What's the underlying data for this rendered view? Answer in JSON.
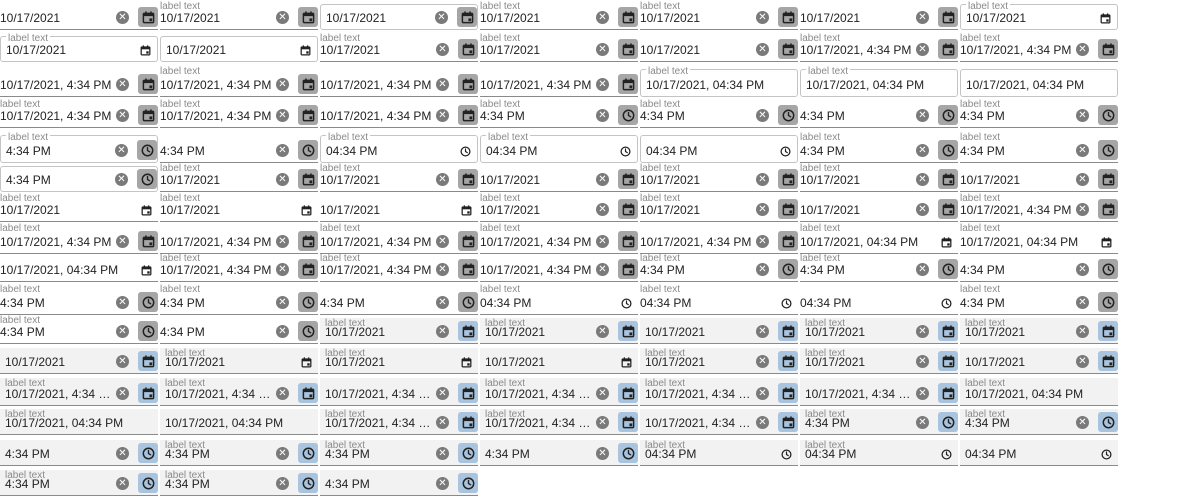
{
  "label": "label text",
  "icons": {
    "clear": "clear-icon",
    "calendar": "calendar-icon",
    "clock": "clock-icon"
  },
  "colors": {
    "button_gray": "#a6a6a6",
    "button_blue": "#a9c4de",
    "label_gray": "#8a8a8a"
  },
  "fields": [
    {
      "v": "10/17/2021",
      "lb": false,
      "st": "u",
      "c": true,
      "ic": "cal",
      "ik": "btn",
      "tn": "g"
    },
    {
      "v": "10/17/2021",
      "lb": true,
      "st": "u",
      "c": true,
      "ic": "cal",
      "ik": "btn",
      "tn": "g"
    },
    {
      "v": "10/17/2021",
      "lb": false,
      "st": "o",
      "c": true,
      "ic": "cal",
      "ik": "btn",
      "tn": "g"
    },
    {
      "v": "10/17/2021",
      "lb": true,
      "st": "u",
      "c": true,
      "ic": "cal",
      "ik": "btn",
      "tn": "g"
    },
    {
      "v": "10/17/2021",
      "lb": true,
      "st": "u",
      "c": true,
      "ic": "cal",
      "ik": "btn",
      "tn": "g"
    },
    {
      "v": "10/17/2021",
      "lb": false,
      "st": "u",
      "c": true,
      "ic": "cal",
      "ik": "btn",
      "tn": "g"
    },
    {
      "v": "10/17/2021",
      "lb": true,
      "st": "o",
      "c": false,
      "ic": "cal",
      "ik": "plain",
      "tn": "g"
    },
    {
      "v": "10/17/2021",
      "lb": true,
      "st": "o",
      "c": false,
      "ic": "cal",
      "ik": "plain",
      "tn": "g"
    },
    {
      "v": "10/17/2021",
      "lb": false,
      "st": "o",
      "c": false,
      "ic": "cal",
      "ik": "plain",
      "tn": "g"
    },
    {
      "v": "10/17/2021",
      "lb": true,
      "st": "u",
      "c": true,
      "ic": "cal",
      "ik": "btn",
      "tn": "g"
    },
    {
      "v": "10/17/2021",
      "lb": true,
      "st": "u",
      "c": true,
      "ic": "cal",
      "ik": "btn",
      "tn": "g"
    },
    {
      "v": "10/17/2021",
      "lb": false,
      "st": "u",
      "c": true,
      "ic": "cal",
      "ik": "btn",
      "tn": "g"
    },
    {
      "v": "10/17/2021, 4:34 PM",
      "lb": true,
      "st": "u",
      "c": true,
      "ic": "cal",
      "ik": "btn",
      "tn": "g"
    },
    {
      "v": "10/17/2021, 4:34 PM",
      "lb": true,
      "st": "u",
      "c": true,
      "ic": "cal",
      "ik": "btn",
      "tn": "g"
    },
    {
      "v": "10/17/2021, 4:34 PM",
      "lb": false,
      "st": "u",
      "c": true,
      "ic": "cal",
      "ik": "btn",
      "tn": "g"
    },
    {
      "v": "10/17/2021, 4:34 PM",
      "lb": true,
      "st": "u",
      "c": true,
      "ic": "cal",
      "ik": "btn",
      "tn": "g"
    },
    {
      "v": "10/17/2021, 4:34 PM",
      "lb": false,
      "st": "u",
      "c": true,
      "ic": "cal",
      "ik": "btn",
      "tn": "g"
    },
    {
      "v": "10/17/2021, 4:34 PM",
      "lb": false,
      "st": "u",
      "c": true,
      "ic": "cal",
      "ik": "btn",
      "tn": "g"
    },
    {
      "v": "10/17/2021, 04:34  PM",
      "lb": true,
      "st": "o",
      "c": false,
      "ic": "none",
      "ik": "none",
      "tn": "g"
    },
    {
      "v": "10/17/2021, 04:34  PM",
      "lb": true,
      "st": "o",
      "c": false,
      "ic": "none",
      "ik": "none",
      "tn": "g"
    },
    {
      "v": "10/17/2021, 04:34  PM",
      "lb": false,
      "st": "o",
      "c": false,
      "ic": "none",
      "ik": "none",
      "tn": "g"
    },
    {
      "v": "10/17/2021, 4:34 PM",
      "lb": true,
      "st": "u",
      "c": true,
      "ic": "cal",
      "ik": "btn",
      "tn": "g"
    },
    {
      "v": "10/17/2021, 4:34 PM",
      "lb": true,
      "st": "u",
      "c": true,
      "ic": "cal",
      "ik": "btn",
      "tn": "g"
    },
    {
      "v": "10/17/2021, 4:34 PM",
      "lb": false,
      "st": "u",
      "c": true,
      "ic": "cal",
      "ik": "btn",
      "tn": "g"
    },
    {
      "v": "4:34 PM",
      "lb": true,
      "st": "u",
      "c": true,
      "ic": "clk",
      "ik": "btn",
      "tn": "g"
    },
    {
      "v": "4:34 PM",
      "lb": true,
      "st": "u",
      "c": true,
      "ic": "clk",
      "ik": "btn",
      "tn": "g"
    },
    {
      "v": "4:34 PM",
      "lb": false,
      "st": "u",
      "c": true,
      "ic": "clk",
      "ik": "btn",
      "tn": "g"
    },
    {
      "v": "4:34 PM",
      "lb": true,
      "st": "u",
      "c": true,
      "ic": "clk",
      "ik": "btn",
      "tn": "g"
    },
    {
      "v": "4:34 PM",
      "lb": true,
      "st": "o",
      "c": true,
      "ic": "clk",
      "ik": "btn",
      "tn": "g"
    },
    {
      "v": "4:34 PM",
      "lb": false,
      "st": "u",
      "c": true,
      "ic": "clk",
      "ik": "btn",
      "tn": "g"
    },
    {
      "v": "04:34  PM",
      "lb": true,
      "st": "o",
      "c": false,
      "ic": "clk",
      "ik": "plain",
      "tn": "g"
    },
    {
      "v": "04:34  PM",
      "lb": true,
      "st": "o",
      "c": false,
      "ic": "clk",
      "ik": "plain",
      "tn": "g"
    },
    {
      "v": "04:34  PM",
      "lb": false,
      "st": "o",
      "c": false,
      "ic": "clk",
      "ik": "plain",
      "tn": "g"
    },
    {
      "v": "4:34 PM",
      "lb": true,
      "st": "u",
      "c": true,
      "ic": "clk",
      "ik": "btn",
      "tn": "g"
    },
    {
      "v": "4:34 PM",
      "lb": true,
      "st": "u",
      "c": true,
      "ic": "clk",
      "ik": "btn",
      "tn": "g"
    },
    {
      "v": "4:34 PM",
      "lb": false,
      "st": "o",
      "c": true,
      "ic": "clk",
      "ik": "btn",
      "tn": "g"
    },
    {
      "v": "10/17/2021",
      "lb": true,
      "st": "u",
      "c": true,
      "ic": "cal",
      "ik": "btn",
      "tn": "g"
    },
    {
      "v": "10/17/2021",
      "lb": true,
      "st": "u",
      "c": true,
      "ic": "cal",
      "ik": "btn",
      "tn": "g"
    },
    {
      "v": "10/17/2021",
      "lb": false,
      "st": "u",
      "c": true,
      "ic": "cal",
      "ik": "btn",
      "tn": "g"
    },
    {
      "v": "10/17/2021",
      "lb": true,
      "st": "u",
      "c": true,
      "ic": "cal",
      "ik": "btn",
      "tn": "g"
    },
    {
      "v": "10/17/2021",
      "lb": true,
      "st": "u",
      "c": true,
      "ic": "cal",
      "ik": "btn",
      "tn": "g"
    },
    {
      "v": "10/17/2021",
      "lb": false,
      "st": "u",
      "c": true,
      "ic": "cal",
      "ik": "btn",
      "tn": "g"
    },
    {
      "v": "10/17/2021",
      "lb": true,
      "st": "u",
      "c": false,
      "ic": "cal",
      "ik": "plain",
      "tn": "g"
    },
    {
      "v": "10/17/2021",
      "lb": true,
      "st": "u",
      "c": false,
      "ic": "cal",
      "ik": "plain",
      "tn": "g"
    },
    {
      "v": "10/17/2021",
      "lb": false,
      "st": "u",
      "c": false,
      "ic": "cal",
      "ik": "plain",
      "tn": "g"
    },
    {
      "v": "10/17/2021",
      "lb": true,
      "st": "u",
      "c": true,
      "ic": "cal",
      "ik": "btn",
      "tn": "g"
    },
    {
      "v": "10/17/2021",
      "lb": true,
      "st": "u",
      "c": true,
      "ic": "cal",
      "ik": "btn",
      "tn": "g"
    },
    {
      "v": "10/17/2021",
      "lb": false,
      "st": "u",
      "c": true,
      "ic": "cal",
      "ik": "btn",
      "tn": "g"
    },
    {
      "v": "10/17/2021, 4:34 PM",
      "lb": true,
      "st": "u",
      "c": true,
      "ic": "cal",
      "ik": "btn",
      "tn": "g"
    },
    {
      "v": "10/17/2021, 4:34 PM",
      "lb": true,
      "st": "u",
      "c": true,
      "ic": "cal",
      "ik": "btn",
      "tn": "g"
    },
    {
      "v": "10/17/2021, 4:34 PM",
      "lb": false,
      "st": "u",
      "c": true,
      "ic": "cal",
      "ik": "btn",
      "tn": "g"
    },
    {
      "v": "10/17/2021, 4:34 PM",
      "lb": true,
      "st": "u",
      "c": true,
      "ic": "cal",
      "ik": "btn",
      "tn": "g"
    },
    {
      "v": "10/17/2021, 4:34 PM",
      "lb": true,
      "st": "u",
      "c": true,
      "ic": "cal",
      "ik": "btn",
      "tn": "g"
    },
    {
      "v": "10/17/2021, 4:34 PM",
      "lb": false,
      "st": "u",
      "c": true,
      "ic": "cal",
      "ik": "btn",
      "tn": "g"
    },
    {
      "v": "10/17/2021, 04:34  PM",
      "lb": true,
      "st": "u",
      "c": false,
      "ic": "cal",
      "ik": "plain",
      "tn": "g"
    },
    {
      "v": "10/17/2021, 04:34  PM",
      "lb": true,
      "st": "u",
      "c": false,
      "ic": "cal",
      "ik": "plain",
      "tn": "g"
    },
    {
      "v": "10/17/2021, 04:34  PM",
      "lb": false,
      "st": "u",
      "c": false,
      "ic": "cal",
      "ik": "plain",
      "tn": "g"
    },
    {
      "v": "10/17/2021, 4:34 PM",
      "lb": true,
      "st": "u",
      "c": true,
      "ic": "cal",
      "ik": "btn",
      "tn": "g"
    },
    {
      "v": "10/17/2021, 4:34 PM",
      "lb": true,
      "st": "u",
      "c": true,
      "ic": "cal",
      "ik": "btn",
      "tn": "g"
    },
    {
      "v": "10/17/2021, 4:34 PM",
      "lb": false,
      "st": "u",
      "c": true,
      "ic": "cal",
      "ik": "btn",
      "tn": "g"
    },
    {
      "v": "4:34 PM",
      "lb": true,
      "st": "u",
      "c": true,
      "ic": "clk",
      "ik": "btn",
      "tn": "g"
    },
    {
      "v": "4:34 PM",
      "lb": true,
      "st": "u",
      "c": true,
      "ic": "clk",
      "ik": "btn",
      "tn": "g"
    },
    {
      "v": "4:34 PM",
      "lb": false,
      "st": "u",
      "c": true,
      "ic": "clk",
      "ik": "btn",
      "tn": "g"
    },
    {
      "v": "4:34 PM",
      "lb": true,
      "st": "u",
      "c": true,
      "ic": "clk",
      "ik": "btn",
      "tn": "g"
    },
    {
      "v": "4:34 PM",
      "lb": true,
      "st": "u",
      "c": true,
      "ic": "clk",
      "ik": "btn",
      "tn": "g"
    },
    {
      "v": "4:34 PM",
      "lb": false,
      "st": "u",
      "c": true,
      "ic": "clk",
      "ik": "btn",
      "tn": "g"
    },
    {
      "v": "04:34  PM",
      "lb": true,
      "st": "u",
      "c": false,
      "ic": "clk",
      "ik": "plain",
      "tn": "g"
    },
    {
      "v": "04:34  PM",
      "lb": true,
      "st": "u",
      "c": false,
      "ic": "clk",
      "ik": "plain",
      "tn": "g"
    },
    {
      "v": "04:34  PM",
      "lb": false,
      "st": "u",
      "c": false,
      "ic": "clk",
      "ik": "plain",
      "tn": "g"
    },
    {
      "v": "4:34 PM",
      "lb": true,
      "st": "u",
      "c": true,
      "ic": "clk",
      "ik": "btn",
      "tn": "g"
    },
    {
      "v": "4:34 PM",
      "lb": true,
      "st": "u",
      "c": true,
      "ic": "clk",
      "ik": "btn",
      "tn": "g"
    },
    {
      "v": "4:34 PM",
      "lb": false,
      "st": "u",
      "c": true,
      "ic": "clk",
      "ik": "btn",
      "tn": "g"
    },
    {
      "v": "10/17/2021",
      "lb": true,
      "st": "f",
      "c": true,
      "ic": "cal",
      "ik": "btn",
      "tn": "b"
    },
    {
      "v": "10/17/2021",
      "lb": true,
      "st": "f",
      "c": true,
      "ic": "cal",
      "ik": "btn",
      "tn": "b"
    },
    {
      "v": "10/17/2021",
      "lb": false,
      "st": "f",
      "c": true,
      "ic": "cal",
      "ik": "btn",
      "tn": "b"
    },
    {
      "v": "10/17/2021",
      "lb": true,
      "st": "f",
      "c": true,
      "ic": "cal",
      "ik": "btn",
      "tn": "b"
    },
    {
      "v": "10/17/2021",
      "lb": true,
      "st": "f",
      "c": true,
      "ic": "cal",
      "ik": "btn",
      "tn": "b"
    },
    {
      "v": "10/17/2021",
      "lb": false,
      "st": "f",
      "c": true,
      "ic": "cal",
      "ik": "btn",
      "tn": "b"
    },
    {
      "v": "10/17/2021",
      "lb": true,
      "st": "f",
      "c": false,
      "ic": "cal",
      "ik": "plain",
      "tn": "b"
    },
    {
      "v": "10/17/2021",
      "lb": true,
      "st": "f",
      "c": false,
      "ic": "cal",
      "ik": "plain",
      "tn": "b"
    },
    {
      "v": "10/17/2021",
      "lb": false,
      "st": "f",
      "c": false,
      "ic": "cal",
      "ik": "plain",
      "tn": "b"
    },
    {
      "v": "10/17/2021",
      "lb": true,
      "st": "f",
      "c": true,
      "ic": "cal",
      "ik": "btn",
      "tn": "b"
    },
    {
      "v": "10/17/2021",
      "lb": true,
      "st": "f",
      "c": true,
      "ic": "cal",
      "ik": "btn",
      "tn": "b"
    },
    {
      "v": "10/17/2021",
      "lb": false,
      "st": "f",
      "c": true,
      "ic": "cal",
      "ik": "btn",
      "tn": "b"
    },
    {
      "v": "10/17/2021, 4:34 PM",
      "lb": true,
      "st": "f",
      "c": true,
      "ic": "cal",
      "ik": "btn",
      "tn": "b"
    },
    {
      "v": "10/17/2021, 4:34 PM",
      "lb": true,
      "st": "f",
      "c": true,
      "ic": "cal",
      "ik": "btn",
      "tn": "b"
    },
    {
      "v": "10/17/2021, 4:34 PM",
      "lb": false,
      "st": "f",
      "c": true,
      "ic": "cal",
      "ik": "btn",
      "tn": "b"
    },
    {
      "v": "10/17/2021, 4:34 PM",
      "lb": true,
      "st": "f",
      "c": true,
      "ic": "cal",
      "ik": "btn",
      "tn": "b"
    },
    {
      "v": "10/17/2021, 4:34 PM",
      "lb": true,
      "st": "f",
      "c": true,
      "ic": "cal",
      "ik": "btn",
      "tn": "b"
    },
    {
      "v": "10/17/2021, 4:34 PM",
      "lb": false,
      "st": "f",
      "c": true,
      "ic": "cal",
      "ik": "btn",
      "tn": "b"
    },
    {
      "v": "10/17/2021, 04:34  PM",
      "lb": true,
      "st": "f",
      "c": false,
      "ic": "none",
      "ik": "none",
      "tn": "b"
    },
    {
      "v": "10/17/2021, 04:34  PM",
      "lb": true,
      "st": "f",
      "c": false,
      "ic": "none",
      "ik": "none",
      "tn": "b"
    },
    {
      "v": "10/17/2021, 04:34  PM",
      "lb": false,
      "st": "f",
      "c": false,
      "ic": "none",
      "ik": "none",
      "tn": "b"
    },
    {
      "v": "10/17/2021, 4:34 PM",
      "lb": true,
      "st": "f",
      "c": true,
      "ic": "cal",
      "ik": "btn",
      "tn": "b"
    },
    {
      "v": "10/17/2021, 4:34 PM",
      "lb": true,
      "st": "f",
      "c": true,
      "ic": "cal",
      "ik": "btn",
      "tn": "b"
    },
    {
      "v": "10/17/2021, 4:34 PM",
      "lb": false,
      "st": "f",
      "c": true,
      "ic": "cal",
      "ik": "btn",
      "tn": "b"
    },
    {
      "v": "4:34 PM",
      "lb": true,
      "st": "f",
      "c": true,
      "ic": "clk",
      "ik": "btn",
      "tn": "b"
    },
    {
      "v": "4:34 PM",
      "lb": true,
      "st": "f",
      "c": true,
      "ic": "clk",
      "ik": "btn",
      "tn": "b"
    },
    {
      "v": "4:34 PM",
      "lb": false,
      "st": "f",
      "c": true,
      "ic": "clk",
      "ik": "btn",
      "tn": "b"
    },
    {
      "v": "4:34 PM",
      "lb": true,
      "st": "f",
      "c": true,
      "ic": "clk",
      "ik": "btn",
      "tn": "b"
    },
    {
      "v": "4:34 PM",
      "lb": true,
      "st": "f",
      "c": true,
      "ic": "clk",
      "ik": "btn",
      "tn": "b"
    },
    {
      "v": "4:34 PM",
      "lb": false,
      "st": "f",
      "c": true,
      "ic": "clk",
      "ik": "btn",
      "tn": "b"
    },
    {
      "v": "04:34  PM",
      "lb": true,
      "st": "f",
      "c": false,
      "ic": "clk",
      "ik": "plain",
      "tn": "b"
    },
    {
      "v": "04:34  PM",
      "lb": true,
      "st": "f",
      "c": false,
      "ic": "clk",
      "ik": "plain",
      "tn": "b"
    },
    {
      "v": "04:34  PM",
      "lb": false,
      "st": "f",
      "c": false,
      "ic": "clk",
      "ik": "plain",
      "tn": "b"
    },
    {
      "v": "4:34 PM",
      "lb": true,
      "st": "f",
      "c": true,
      "ic": "clk",
      "ik": "btn",
      "tn": "b"
    },
    {
      "v": "4:34 PM",
      "lb": true,
      "st": "f",
      "c": true,
      "ic": "clk",
      "ik": "btn",
      "tn": "b"
    },
    {
      "v": "4:34 PM",
      "lb": false,
      "st": "f",
      "c": true,
      "ic": "clk",
      "ik": "btn",
      "tn": "b"
    }
  ]
}
